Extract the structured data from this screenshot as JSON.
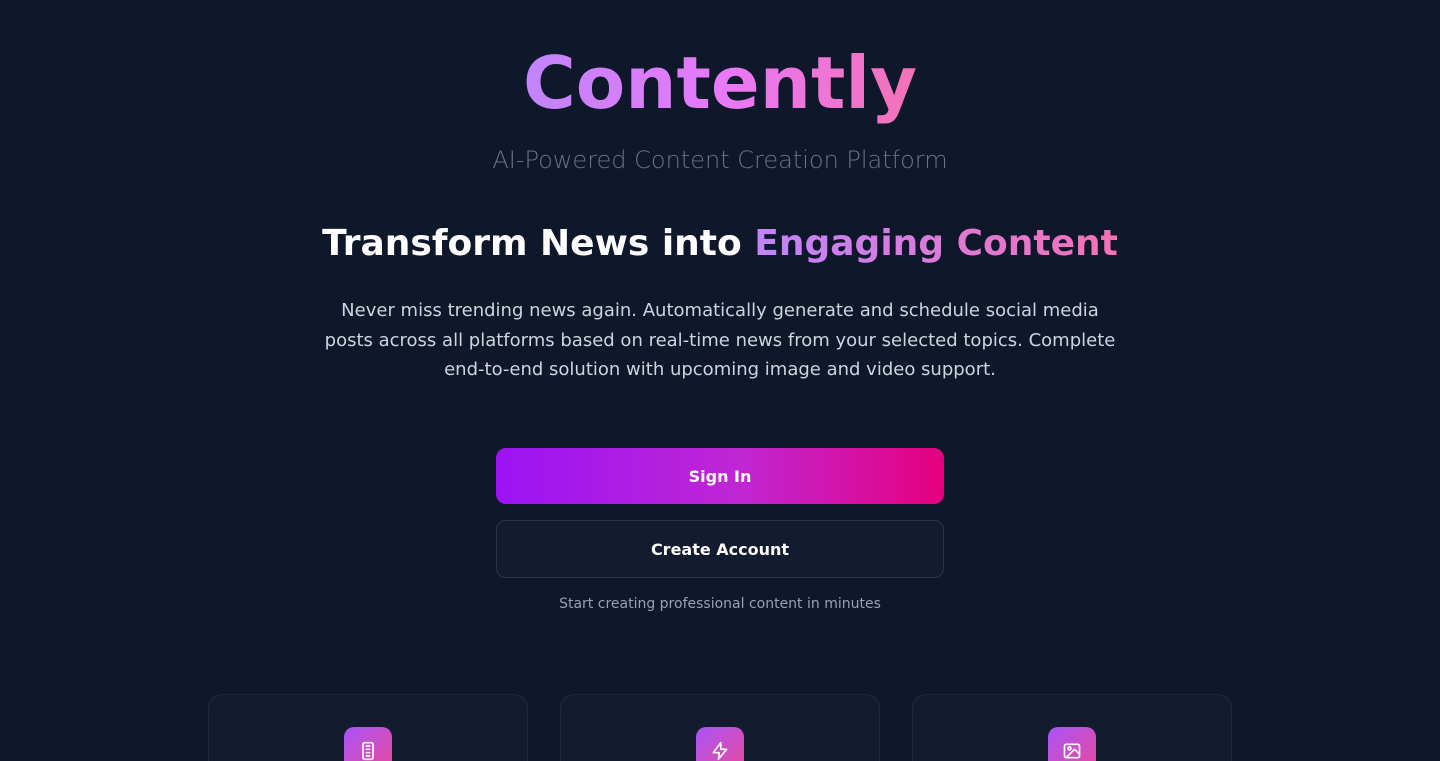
{
  "brand": {
    "name": "Contently",
    "tagline": "AI-Powered Content Creation Platform"
  },
  "hero": {
    "headline_plain": "Transform News into ",
    "headline_accent": "Engaging Content",
    "description": "Never miss trending news again. Automatically generate and schedule social media posts across all platforms based on real-time news from your selected topics. Complete end-to-end solution with upcoming image and video support."
  },
  "actions": {
    "sign_in_label": "Sign In",
    "create_account_label": "Create Account",
    "subnote": "Start creating professional content in minutes"
  },
  "features": [
    {
      "icon": "smartphone-icon"
    },
    {
      "icon": "lightning-icon"
    },
    {
      "icon": "image-icon"
    }
  ],
  "colors": {
    "background": "#0f172a",
    "accent_purple": "#9b13f5",
    "accent_pink": "#e6007e",
    "card_background": "#131c2e"
  }
}
